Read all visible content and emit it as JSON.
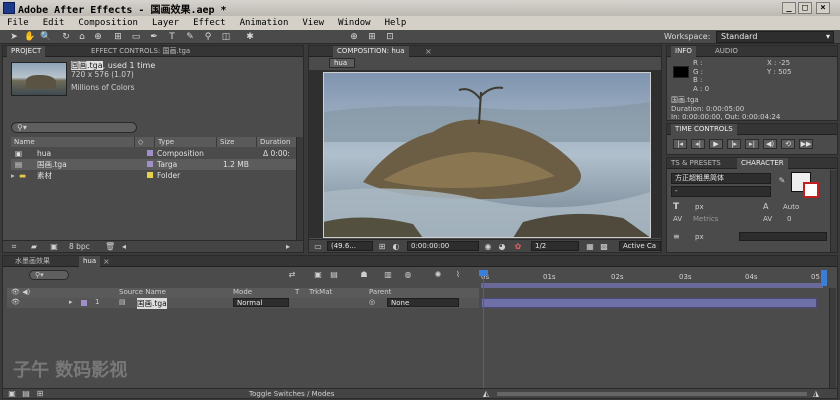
{
  "window": {
    "title": "Adobe After Effects - 国画效果.aep *",
    "controls": [
      "_",
      "□",
      "×"
    ]
  },
  "menu": [
    "File",
    "Edit",
    "Composition",
    "Layer",
    "Effect",
    "Animation",
    "View",
    "Window",
    "Help"
  ],
  "toolbar": {
    "workspace_label": "Workspace:",
    "workspace_value": "Standard"
  },
  "project_panel": {
    "tabs": [
      "PROJECT",
      "EFFECT CONTROLS: 国画.tga"
    ],
    "preview": {
      "name": "国画.tga",
      "used": ", used 1 time",
      "dims": "720 x 576 (1.07)",
      "colors": "Millions of Colors"
    },
    "search_placeholder": "",
    "columns": [
      "Name",
      "Type",
      "Size",
      "Duration"
    ],
    "items": [
      {
        "name": "hua",
        "type": "Composition",
        "size": "",
        "duration": "Δ 0:00:",
        "color": "#a08fc8"
      },
      {
        "name": "国画.tga",
        "type": "Targa",
        "size": "1.2 MB",
        "duration": "",
        "color": "#a08fc8"
      },
      {
        "name": "素材",
        "type": "Folder",
        "size": "",
        "duration": "",
        "color": "#e6d24a"
      }
    ],
    "footer_bpc": "8 bpc"
  },
  "comp_panel": {
    "tab": "COMPOSITION: hua",
    "comp_label": "hua",
    "zoom": "(49.6...",
    "timecode": "0:00:00:00",
    "resolution": "1/2",
    "camera": "Active Ca"
  },
  "info_panel": {
    "tabs": [
      "INFO",
      "AUDIO"
    ],
    "rgba": [
      "R :",
      "G :",
      "B :",
      "A : 0"
    ],
    "x": "X : -25",
    "y": "Y : 505",
    "file": "国画.tga",
    "duration": "Duration: 0:00:05:00",
    "inout": "In: 0:00:00:00, Out: 0:00:04:24"
  },
  "time_controls": {
    "tab": "TIME CONTROLS"
  },
  "character_panel": {
    "tabs": [
      "TS & PRESETS",
      "CHARACTER"
    ],
    "font": "方正超粗黑简体",
    "style": "-",
    "size_unit": "px",
    "leading": "Auto",
    "kerning": "Metrics",
    "tracking": "0",
    "stroke_unit": "px"
  },
  "timeline": {
    "tabs": [
      "水墨画效果",
      "hua"
    ],
    "columns": {
      "source": "Source Name",
      "mode": "Mode",
      "t": "T",
      "trkmat": "TrkMat",
      "parent": "Parent"
    },
    "layer": {
      "index": "1",
      "name": "国画.tga",
      "mode": "Normal",
      "parent": "None"
    },
    "ruler": [
      "0s",
      "01s",
      "02s",
      "03s",
      "04s",
      "05"
    ],
    "footer": "Toggle Switches / Modes"
  },
  "watermark": "子午 数码影视"
}
